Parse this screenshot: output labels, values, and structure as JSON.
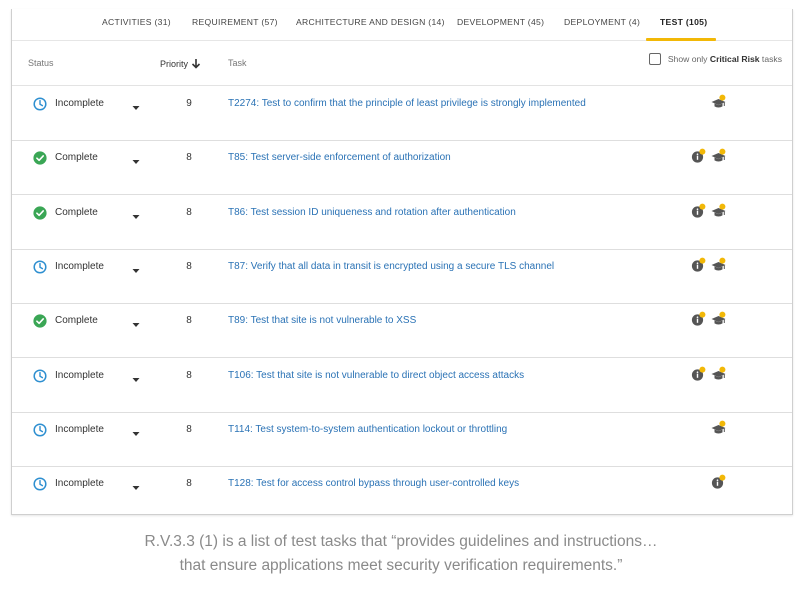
{
  "tabs": [
    {
      "label": "ACTIVITIES (31)",
      "active": false
    },
    {
      "label": "REQUIREMENT (57)",
      "active": false
    },
    {
      "label": "ARCHITECTURE AND DESIGN (14)",
      "active": false
    },
    {
      "label": "DEVELOPMENT (45)",
      "active": false
    },
    {
      "label": "DEPLOYMENT (4)",
      "active": false
    },
    {
      "label": "TEST (105)",
      "active": true
    }
  ],
  "header": {
    "status": "Status",
    "priority": "Priority",
    "task": "Task",
    "critical_prefix": "Show only ",
    "critical_bold": "Critical Risk",
    "critical_suffix": " tasks"
  },
  "rows": [
    {
      "status": "Incomplete",
      "priority": "9",
      "task": "T2274: Test to confirm that the principle of least privilege is strongly implemented",
      "badges": [
        "training-icon"
      ]
    },
    {
      "status": "Complete",
      "priority": "8",
      "task": "T85: Test server-side enforcement of authorization",
      "badges": [
        "info-icon",
        "training-icon"
      ]
    },
    {
      "status": "Complete",
      "priority": "8",
      "task": "T86: Test session ID uniqueness and rotation after authentication",
      "badges": [
        "info-icon",
        "training-icon"
      ]
    },
    {
      "status": "Incomplete",
      "priority": "8",
      "task": "T87: Verify that all data in transit is encrypted using a secure TLS channel",
      "badges": [
        "info-icon",
        "training-icon"
      ]
    },
    {
      "status": "Complete",
      "priority": "8",
      "task": "T89: Test that site is not vulnerable to XSS",
      "badges": [
        "info-icon",
        "training-icon"
      ]
    },
    {
      "status": "Incomplete",
      "priority": "8",
      "task": "T106: Test that site is not vulnerable to direct object access attacks",
      "badges": [
        "info-icon",
        "training-icon"
      ]
    },
    {
      "status": "Incomplete",
      "priority": "8",
      "task": "T114: Test system-to-system authentication lockout or throttling",
      "badges": [
        "training-icon"
      ]
    },
    {
      "status": "Incomplete",
      "priority": "8",
      "task": "T128: Test for access control bypass through user-controlled keys",
      "badges": [
        "info-icon"
      ]
    }
  ],
  "caption": {
    "line1": "R.V.3.3 (1) is a list of test tasks that “provides guidelines and instructions…",
    "line2": "that ensure applications meet security verification requirements.”"
  },
  "colors": {
    "accent": "#f2b807",
    "link": "#2a72b5",
    "complete": "#3aa655",
    "incomplete": "#2e8fd0"
  }
}
